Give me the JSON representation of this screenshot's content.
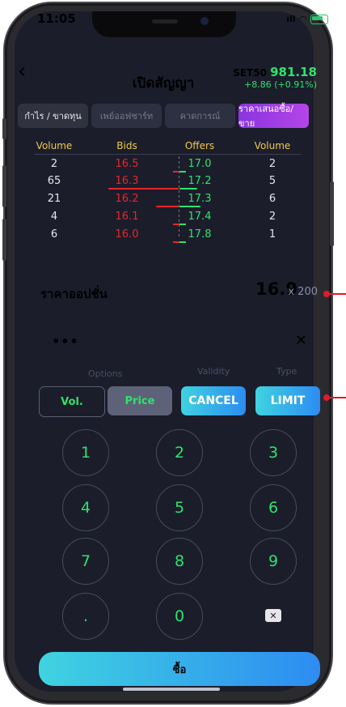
{
  "status": {
    "time": "11:05"
  },
  "header": {
    "title": "เปิดสัญญา",
    "index_name": "SET50",
    "index_value": "981.18",
    "index_change": "+8.86 (+0.91%)"
  },
  "tabs": [
    "กำไร / ขาดทุน",
    "เพย์ออฟชาร์ท",
    "คาดการณ์",
    "ราคาเสนอซื้อ/ขาย"
  ],
  "orderbook": {
    "headers": [
      "Volume",
      "Bids",
      "Offers",
      "Volume"
    ],
    "rows": [
      {
        "bid_vol": "2",
        "bid": "16.5",
        "offer": "17.0",
        "offer_vol": "2"
      },
      {
        "bid_vol": "65",
        "bid": "16.3",
        "offer": "17.2",
        "offer_vol": "5"
      },
      {
        "bid_vol": "21",
        "bid": "16.2",
        "offer": "17.3",
        "offer_vol": "6"
      },
      {
        "bid_vol": "4",
        "bid": "16.1",
        "offer": "17.4",
        "offer_vol": "2"
      },
      {
        "bid_vol": "6",
        "bid": "16.0",
        "offer": "17.8",
        "offer_vol": "1"
      }
    ]
  },
  "option": {
    "label": "ราคาออปชั่น",
    "price": "16.9",
    "qty": "x 200"
  },
  "panel": {
    "more": "•••",
    "close": "✕",
    "options_label": "Options",
    "validity_label": "Validity",
    "type_label": "Type",
    "vol_label": "Vol.",
    "price_label": "Price",
    "cancel_label": "CANCEL",
    "limit_label": "LIMIT"
  },
  "keypad": [
    "1",
    "2",
    "3",
    "4",
    "5",
    "6",
    "7",
    "8",
    "9",
    ".",
    "0"
  ],
  "buy_label": "ซื้อ",
  "colors": {
    "accent_green": "#2ee36a",
    "bid_red": "#e8262b",
    "header_yellow": "#f2c94c",
    "tab_purple": "#8b35e0",
    "button_cyan": "#3fd3e0"
  }
}
